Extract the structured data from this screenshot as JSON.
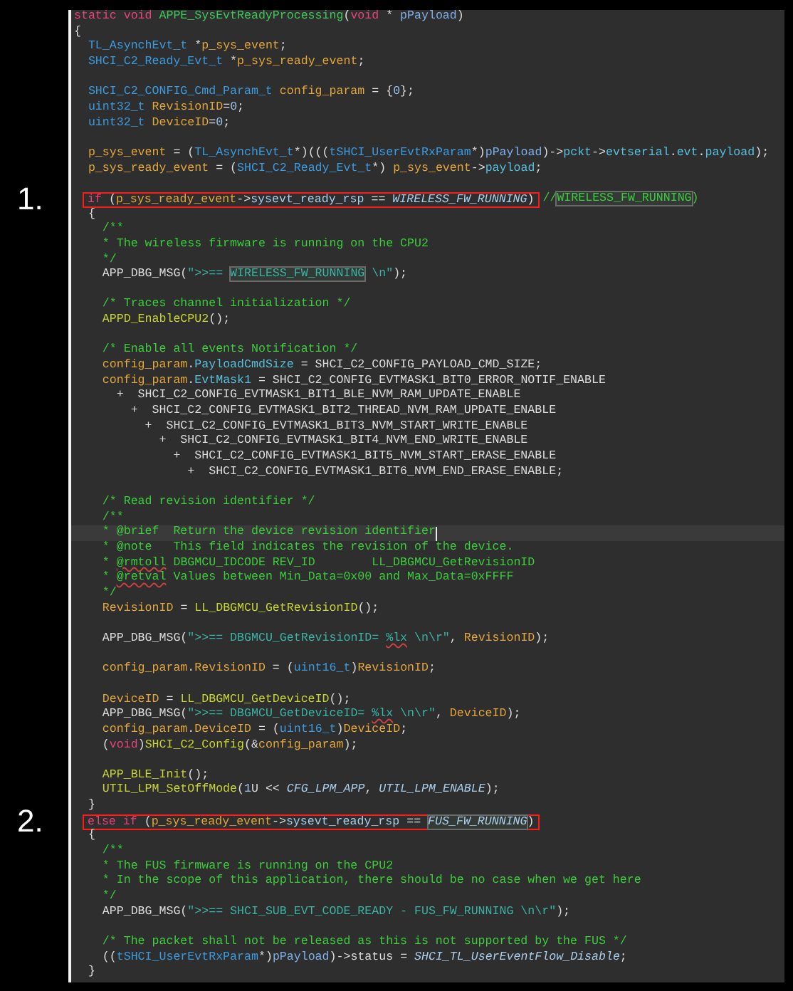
{
  "lines": [
    {
      "kind": "code",
      "tokens": [
        {
          "text": "static void ",
          "kind": "keyword"
        },
        {
          "text": "APPE_SysEvtReadyProcessing",
          "kind": "definition"
        },
        {
          "text": "(",
          "kind": "plain"
        },
        {
          "text": "void",
          "kind": "keyword"
        },
        {
          "text": " * ",
          "kind": "plain"
        },
        {
          "text": "pPayload",
          "kind": "parameter"
        },
        {
          "text": ")",
          "kind": "plain"
        }
      ]
    },
    {
      "kind": "code",
      "tokens": [
        {
          "text": "{",
          "kind": "plain"
        }
      ]
    },
    {
      "kind": "code",
      "tokens": [
        {
          "text": "  TL_AsynchEvt_t",
          "kind": "type"
        },
        {
          "text": " *",
          "kind": "plain"
        },
        {
          "text": "p_sys_event",
          "kind": "variable"
        },
        {
          "text": ";",
          "kind": "plain"
        }
      ]
    },
    {
      "kind": "code",
      "tokens": [
        {
          "text": "  SHCI_C2_Ready_Evt_t",
          "kind": "type"
        },
        {
          "text": " *",
          "kind": "plain"
        },
        {
          "text": "p_sys_ready_event",
          "kind": "variable"
        },
        {
          "text": ";",
          "kind": "plain"
        }
      ]
    },
    {
      "kind": "blank"
    },
    {
      "kind": "code",
      "tokens": [
        {
          "text": "  SHCI_C2_CONFIG_Cmd_Param_t ",
          "kind": "type"
        },
        {
          "text": "config_param",
          "kind": "variable"
        },
        {
          "text": " = {",
          "kind": "plain"
        },
        {
          "text": "0",
          "kind": "number"
        },
        {
          "text": "};",
          "kind": "plain"
        }
      ]
    },
    {
      "kind": "code",
      "tokens": [
        {
          "text": "  uint32_t ",
          "kind": "type"
        },
        {
          "text": "RevisionID",
          "kind": "variable"
        },
        {
          "text": "=",
          "kind": "plain"
        },
        {
          "text": "0",
          "kind": "number"
        },
        {
          "text": ";",
          "kind": "plain"
        }
      ]
    },
    {
      "kind": "code",
      "tokens": [
        {
          "text": "  uint32_t ",
          "kind": "type"
        },
        {
          "text": "DeviceID",
          "kind": "variable"
        },
        {
          "text": "=",
          "kind": "plain"
        },
        {
          "text": "0",
          "kind": "number"
        },
        {
          "text": ";",
          "kind": "plain"
        }
      ]
    },
    {
      "kind": "blank"
    },
    {
      "kind": "code",
      "tokens": [
        {
          "text": "  p_sys_event",
          "kind": "variable"
        },
        {
          "text": " = (",
          "kind": "plain"
        },
        {
          "text": "TL_AsynchEvt_t",
          "kind": "type"
        },
        {
          "text": "*)(((",
          "kind": "plain"
        },
        {
          "text": "tSHCI_UserEvtRxParam",
          "kind": "type"
        },
        {
          "text": "*)",
          "kind": "plain"
        },
        {
          "text": "pPayload",
          "kind": "parameter"
        },
        {
          "text": ")->",
          "kind": "plain"
        },
        {
          "text": "pckt",
          "kind": "member"
        },
        {
          "text": "->",
          "kind": "plain"
        },
        {
          "text": "evtserial",
          "kind": "member"
        },
        {
          "text": ".",
          "kind": "plain"
        },
        {
          "text": "evt",
          "kind": "member"
        },
        {
          "text": ".",
          "kind": "plain"
        },
        {
          "text": "payload",
          "kind": "member"
        },
        {
          "text": ");",
          "kind": "plain"
        }
      ]
    },
    {
      "kind": "code",
      "tokens": [
        {
          "text": "  p_sys_ready_event",
          "kind": "variable"
        },
        {
          "text": " = (",
          "kind": "plain"
        },
        {
          "text": "SHCI_C2_Ready_Evt_t",
          "kind": "type"
        },
        {
          "text": "*) ",
          "kind": "plain"
        },
        {
          "text": "p_sys_event",
          "kind": "variable"
        },
        {
          "text": "->",
          "kind": "plain"
        },
        {
          "text": "payload",
          "kind": "member"
        },
        {
          "text": ";",
          "kind": "plain"
        }
      ]
    },
    {
      "kind": "blank"
    },
    {
      "kind": "annotated",
      "callout": "1.",
      "boxed": [
        {
          "text": "if",
          "kind": "keyword"
        },
        {
          "text": " (",
          "kind": "plain"
        },
        {
          "text": "p_sys_ready_event",
          "kind": "variable"
        },
        {
          "text": "->",
          "kind": "plain"
        },
        {
          "text": "sysevt_ready_rsp",
          "kind": "field"
        },
        {
          "text": " == ",
          "kind": "plain"
        },
        {
          "text": "WIRELESS_FW_RUNNING",
          "kind": "constant"
        },
        {
          "text": ")",
          "kind": "plain"
        }
      ],
      "tokens": [
        {
          "text": " //",
          "kind": "comment"
        },
        {
          "text": "WIRELESS_FW_RUNNING",
          "kind": "comment",
          "highlight": true
        },
        {
          "text": ")",
          "kind": "comment"
        }
      ]
    },
    {
      "kind": "code",
      "tokens": [
        {
          "text": "  {",
          "kind": "plain"
        }
      ]
    },
    {
      "kind": "code",
      "tokens": [
        {
          "text": "    /**",
          "kind": "comment"
        }
      ]
    },
    {
      "kind": "code",
      "tokens": [
        {
          "text": "    * The wireless firmware is running on the CPU2",
          "kind": "comment"
        }
      ]
    },
    {
      "kind": "code",
      "tokens": [
        {
          "text": "    */",
          "kind": "comment"
        }
      ]
    },
    {
      "kind": "code",
      "tokens": [
        {
          "text": "    APP_DBG_MSG(",
          "kind": "plain"
        },
        {
          "text": "\">>== ",
          "kind": "string"
        },
        {
          "text": "WIRELESS_FW_RUNNING",
          "kind": "string",
          "highlight": true
        },
        {
          "text": " \\n\"",
          "kind": "string"
        },
        {
          "text": ");",
          "kind": "plain"
        }
      ]
    },
    {
      "kind": "blank"
    },
    {
      "kind": "code",
      "tokens": [
        {
          "text": "    /* Traces channel initialization */",
          "kind": "comment"
        }
      ]
    },
    {
      "kind": "code",
      "tokens": [
        {
          "text": "    APPD_EnableCPU2",
          "kind": "function"
        },
        {
          "text": "();",
          "kind": "plain"
        }
      ]
    },
    {
      "kind": "blank"
    },
    {
      "kind": "code",
      "tokens": [
        {
          "text": "    /* Enable all events Notification */",
          "kind": "comment"
        }
      ]
    },
    {
      "kind": "code",
      "tokens": [
        {
          "text": "    config_param",
          "kind": "variable"
        },
        {
          "text": ".",
          "kind": "plain"
        },
        {
          "text": "PayloadCmdSize",
          "kind": "member"
        },
        {
          "text": " = SHCI_C2_CONFIG_PAYLOAD_CMD_SIZE;",
          "kind": "plain"
        }
      ]
    },
    {
      "kind": "code",
      "tokens": [
        {
          "text": "    config_param",
          "kind": "variable"
        },
        {
          "text": ".",
          "kind": "plain"
        },
        {
          "text": "EvtMask1",
          "kind": "member"
        },
        {
          "text": " = SHCI_C2_CONFIG_EVTMASK1_BIT0_ERROR_NOTIF_ENABLE",
          "kind": "plain"
        }
      ]
    },
    {
      "kind": "code",
      "tokens": [
        {
          "text": "      +  SHCI_C2_CONFIG_EVTMASK1_BIT1_BLE_NVM_RAM_UPDATE_ENABLE",
          "kind": "plain"
        }
      ]
    },
    {
      "kind": "code",
      "tokens": [
        {
          "text": "        +  SHCI_C2_CONFIG_EVTMASK1_BIT2_THREAD_NVM_RAM_UPDATE_ENABLE",
          "kind": "plain"
        }
      ]
    },
    {
      "kind": "code",
      "tokens": [
        {
          "text": "          +  SHCI_C2_CONFIG_EVTMASK1_BIT3_NVM_START_WRITE_ENABLE",
          "kind": "plain"
        }
      ]
    },
    {
      "kind": "code",
      "tokens": [
        {
          "text": "            +  SHCI_C2_CONFIG_EVTMASK1_BIT4_NVM_END_WRITE_ENABLE",
          "kind": "plain"
        }
      ]
    },
    {
      "kind": "code",
      "tokens": [
        {
          "text": "              +  SHCI_C2_CONFIG_EVTMASK1_BIT5_NVM_START_ERASE_ENABLE",
          "kind": "plain"
        }
      ]
    },
    {
      "kind": "code",
      "tokens": [
        {
          "text": "                +  SHCI_C2_CONFIG_EVTMASK1_BIT6_NVM_END_ERASE_ENABLE;",
          "kind": "plain"
        }
      ]
    },
    {
      "kind": "blank"
    },
    {
      "kind": "code",
      "tokens": [
        {
          "text": "    /* Read revision identifier */",
          "kind": "comment"
        }
      ]
    },
    {
      "kind": "code",
      "tokens": [
        {
          "text": "    /**",
          "kind": "comment"
        }
      ]
    },
    {
      "kind": "code",
      "current": true,
      "tokens": [
        {
          "text": "    * @brief  Return the device revision identifier",
          "kind": "comment"
        }
      ]
    },
    {
      "kind": "code",
      "tokens": [
        {
          "text": "    * @note   This field indicates the revision of the device.",
          "kind": "comment"
        }
      ]
    },
    {
      "kind": "code",
      "tokens": [
        {
          "text": "    * ",
          "kind": "comment"
        },
        {
          "text": "@rmtoll",
          "kind": "comment",
          "squiggle": true
        },
        {
          "text": " DBGMCU_IDCODE REV_ID        LL_DBGMCU_GetRevisionID",
          "kind": "comment"
        }
      ]
    },
    {
      "kind": "code",
      "tokens": [
        {
          "text": "    * ",
          "kind": "comment"
        },
        {
          "text": "@retval",
          "kind": "comment",
          "squiggle": true
        },
        {
          "text": " Values between Min_Data=0x00 and Max_Data=0xFFFF",
          "kind": "comment"
        }
      ]
    },
    {
      "kind": "code",
      "tokens": [
        {
          "text": "    */",
          "kind": "comment"
        }
      ]
    },
    {
      "kind": "code",
      "tokens": [
        {
          "text": "    RevisionID",
          "kind": "variable"
        },
        {
          "text": " = ",
          "kind": "plain"
        },
        {
          "text": "LL_DBGMCU_GetRevisionID",
          "kind": "function"
        },
        {
          "text": "();",
          "kind": "plain"
        }
      ]
    },
    {
      "kind": "blank"
    },
    {
      "kind": "code",
      "tokens": [
        {
          "text": "    APP_DBG_MSG(",
          "kind": "plain"
        },
        {
          "text": "\">>== DBGMCU_GetRevisionID= ",
          "kind": "string"
        },
        {
          "text": "%lx",
          "kind": "string",
          "squiggle": true
        },
        {
          "text": " \\n\\r\"",
          "kind": "string"
        },
        {
          "text": ", ",
          "kind": "plain"
        },
        {
          "text": "RevisionID",
          "kind": "variable"
        },
        {
          "text": ");",
          "kind": "plain"
        }
      ]
    },
    {
      "kind": "blank"
    },
    {
      "kind": "code",
      "tokens": [
        {
          "text": "    config_param",
          "kind": "variable"
        },
        {
          "text": ".",
          "kind": "plain"
        },
        {
          "text": "RevisionID",
          "kind": "variable"
        },
        {
          "text": " = (",
          "kind": "plain"
        },
        {
          "text": "uint16_t",
          "kind": "type"
        },
        {
          "text": ")",
          "kind": "plain"
        },
        {
          "text": "RevisionID",
          "kind": "variable"
        },
        {
          "text": ";",
          "kind": "plain"
        }
      ]
    },
    {
      "kind": "blank"
    },
    {
      "kind": "code",
      "tokens": [
        {
          "text": "    DeviceID",
          "kind": "variable"
        },
        {
          "text": " = ",
          "kind": "plain"
        },
        {
          "text": "LL_DBGMCU_GetDeviceID",
          "kind": "function"
        },
        {
          "text": "();",
          "kind": "plain"
        }
      ]
    },
    {
      "kind": "code",
      "tokens": [
        {
          "text": "    APP_DBG_MSG(",
          "kind": "plain"
        },
        {
          "text": "\">>== DBGMCU_GetDeviceID= ",
          "kind": "string"
        },
        {
          "text": "%lx",
          "kind": "string",
          "squiggle": true
        },
        {
          "text": " \\n\\r\"",
          "kind": "string"
        },
        {
          "text": ", ",
          "kind": "plain"
        },
        {
          "text": "DeviceID",
          "kind": "variable"
        },
        {
          "text": ");",
          "kind": "plain"
        }
      ]
    },
    {
      "kind": "code",
      "tokens": [
        {
          "text": "    config_param",
          "kind": "variable"
        },
        {
          "text": ".",
          "kind": "plain"
        },
        {
          "text": "DeviceID",
          "kind": "variable"
        },
        {
          "text": " = (",
          "kind": "plain"
        },
        {
          "text": "uint16_t",
          "kind": "type"
        },
        {
          "text": ")",
          "kind": "plain"
        },
        {
          "text": "DeviceID",
          "kind": "variable"
        },
        {
          "text": ";",
          "kind": "plain"
        }
      ]
    },
    {
      "kind": "code",
      "tokens": [
        {
          "text": "    (",
          "kind": "plain"
        },
        {
          "text": "void",
          "kind": "keyword"
        },
        {
          "text": ")",
          "kind": "plain"
        },
        {
          "text": "SHCI_C2_Config",
          "kind": "function"
        },
        {
          "text": "(&",
          "kind": "plain"
        },
        {
          "text": "config_param",
          "kind": "variable"
        },
        {
          "text": ");",
          "kind": "plain"
        }
      ]
    },
    {
      "kind": "blank"
    },
    {
      "kind": "code",
      "tokens": [
        {
          "text": "    APP_BLE_Init",
          "kind": "function"
        },
        {
          "text": "();",
          "kind": "plain"
        }
      ]
    },
    {
      "kind": "code",
      "tokens": [
        {
          "text": "    UTIL_LPM_SetOffMode",
          "kind": "function"
        },
        {
          "text": "(",
          "kind": "plain"
        },
        {
          "text": "1",
          "kind": "number"
        },
        {
          "text": "U << ",
          "kind": "plain"
        },
        {
          "text": "CFG_LPM_APP",
          "kind": "constant"
        },
        {
          "text": ", ",
          "kind": "plain"
        },
        {
          "text": "UTIL_LPM_ENABLE",
          "kind": "constant"
        },
        {
          "text": ");",
          "kind": "plain"
        }
      ]
    },
    {
      "kind": "code",
      "tokens": [
        {
          "text": "  }",
          "kind": "plain"
        }
      ]
    },
    {
      "kind": "annotated",
      "callout": "2.",
      "boxed": [
        {
          "text": "else if",
          "kind": "keyword"
        },
        {
          "text": " (",
          "kind": "plain"
        },
        {
          "text": "p_sys_ready_event",
          "kind": "variable"
        },
        {
          "text": "->",
          "kind": "plain"
        },
        {
          "text": "sysevt_ready_rsp",
          "kind": "field"
        },
        {
          "text": " == ",
          "kind": "plain"
        },
        {
          "text": "FUS_FW_RUNNING",
          "kind": "constant",
          "highlight": true
        },
        {
          "text": ")",
          "kind": "plain"
        }
      ]
    },
    {
      "kind": "code",
      "tokens": [
        {
          "text": "  {",
          "kind": "plain"
        }
      ]
    },
    {
      "kind": "code",
      "tokens": [
        {
          "text": "    /**",
          "kind": "comment"
        }
      ]
    },
    {
      "kind": "code",
      "tokens": [
        {
          "text": "    * The FUS firmware is running on the CPU2",
          "kind": "comment"
        }
      ]
    },
    {
      "kind": "code",
      "tokens": [
        {
          "text": "    * In the scope of this application, there should be no case when we get here",
          "kind": "comment"
        }
      ]
    },
    {
      "kind": "code",
      "tokens": [
        {
          "text": "    */",
          "kind": "comment"
        }
      ]
    },
    {
      "kind": "code",
      "tokens": [
        {
          "text": "    APP_DBG_MSG(",
          "kind": "plain"
        },
        {
          "text": "\">>== SHCI_SUB_EVT_CODE_READY - FUS_FW_RUNNING \\n\\r\"",
          "kind": "string"
        },
        {
          "text": ");",
          "kind": "plain"
        }
      ]
    },
    {
      "kind": "blank"
    },
    {
      "kind": "code",
      "tokens": [
        {
          "text": "    /* The packet shall not be released as this is not supported by the FUS */",
          "kind": "comment"
        }
      ]
    },
    {
      "kind": "code",
      "tokens": [
        {
          "text": "    ((",
          "kind": "plain"
        },
        {
          "text": "tSHCI_UserEvtRxParam",
          "kind": "type"
        },
        {
          "text": "*)",
          "kind": "plain"
        },
        {
          "text": "pPayload",
          "kind": "parameter"
        },
        {
          "text": ")->status = ",
          "kind": "plain"
        },
        {
          "text": "SHCI_TL_UserEventFlow_Disable",
          "kind": "constant"
        },
        {
          "text": ";",
          "kind": "plain"
        }
      ]
    },
    {
      "kind": "code",
      "tokens": [
        {
          "text": "  }",
          "kind": "plain"
        }
      ]
    }
  ]
}
